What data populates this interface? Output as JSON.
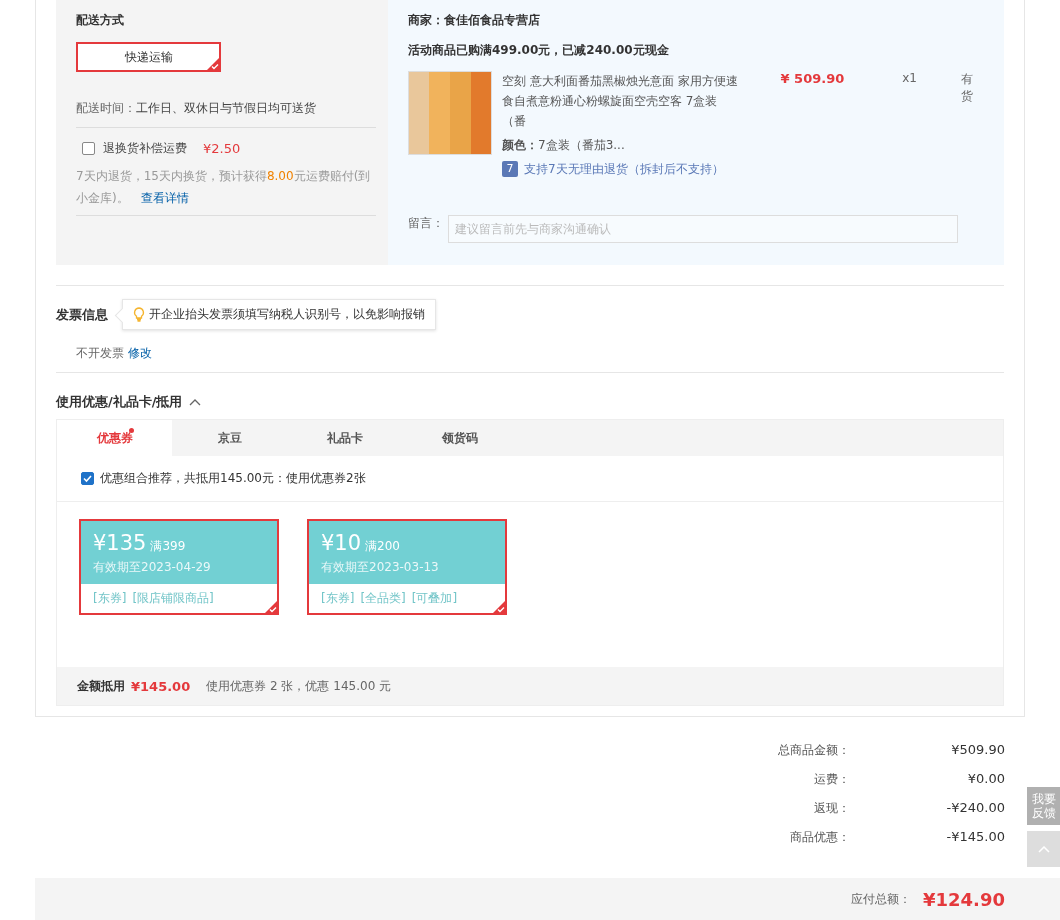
{
  "delivery": {
    "title": "配送方式",
    "options": [
      {
        "label": "快递运输",
        "selected": true
      }
    ],
    "time_label": "配送时间：",
    "time_value": "工作日、双休日与节假日均可送货",
    "insurance": {
      "label": "退换货补偿运费",
      "price": "¥2.50",
      "checked": false
    },
    "note_start": "7天内退货，15天内换货，预计获得",
    "note_amount": "8.00",
    "note_end": "元运费赔付(到小金库)。",
    "details_link": "查看详情"
  },
  "shop": {
    "merchant": "商家：食佳佰食品专营店",
    "promo": "活动商品已购满499.00元，已减240.00元现金",
    "item": {
      "name": "空刻 意大利面番茄黑椒烛光意面 家用方便速食自煮意粉通心粉螺旋面空壳空客 7盒装（番",
      "color_label": "颜色：",
      "color_value": "7盒装（番茄3...",
      "price": "¥ 509.90",
      "qty": "x1",
      "stock": "有货",
      "return_badge": "7",
      "return_policy": "支持7天无理由退货（拆封后不支持）"
    },
    "message_label": "留言：",
    "message_placeholder": "建议留言前先与商家沟通确认"
  },
  "invoice": {
    "title": "发票信息",
    "tip": "开企业抬头发票须填写纳税人识别号，以免影响报销",
    "status": "不开发票",
    "edit_link": "修改"
  },
  "discounts": {
    "title": "使用优惠/礼品卡/抵用",
    "expanded": true,
    "tabs": [
      {
        "label": "优惠券",
        "selected": true,
        "dot": true
      },
      {
        "label": "京豆",
        "selected": false,
        "dot": false
      },
      {
        "label": "礼品卡",
        "selected": false,
        "dot": false
      },
      {
        "label": "领货码",
        "selected": false,
        "dot": false
      }
    ],
    "recommend": {
      "checked": true,
      "label": "优惠组合推荐，共抵用145.00元：使用优惠券2张"
    },
    "coupons": [
      {
        "amount": "¥135",
        "threshold": "满399",
        "expiry": "有效期至2023-04-29",
        "tags": [
          "[东券]",
          "[限店铺限商品]"
        ],
        "selected": true
      },
      {
        "amount": "¥10",
        "threshold": "满200",
        "expiry": "有效期至2023-03-13",
        "tags": [
          "[东券]",
          "[全品类]",
          "[可叠加]"
        ],
        "selected": true
      }
    ],
    "summary": {
      "label": "金额抵用",
      "amount": "¥145.00",
      "detail": "使用优惠券 2 张，优惠 145.00 元"
    }
  },
  "totals": [
    {
      "label": "总商品金额：",
      "value": "¥509.90"
    },
    {
      "label": "运费：",
      "value": "¥0.00"
    },
    {
      "label": "返现：",
      "value": "-¥240.00"
    },
    {
      "label": "商品优惠：",
      "value": "-¥145.00"
    }
  ],
  "payable": {
    "label": "应付总额：",
    "value": "¥124.90"
  },
  "side": {
    "feedback": "我要反馈"
  }
}
